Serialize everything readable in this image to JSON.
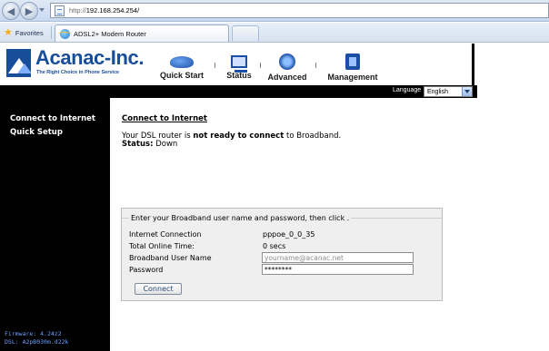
{
  "browser": {
    "address": {
      "scheme": "http://",
      "host": "192.168.254.254/"
    },
    "favorites_label": "Favorites",
    "tab_title": "ADSL2+ Modem Router"
  },
  "header": {
    "logo_name": "Acanac-Inc.",
    "logo_tagline": "The Right Choice in Phone Service",
    "menu": [
      {
        "label": "Quick Start",
        "icon": "quick-start-icon"
      },
      {
        "label": "Status",
        "icon": "monitor-icon"
      },
      {
        "label": "Advanced",
        "icon": "gear-icon"
      },
      {
        "label": "Management",
        "icon": "management-icon"
      }
    ],
    "language_label": "Language",
    "language_value": "English"
  },
  "sidebar": {
    "items": [
      {
        "label": "Connect to Internet"
      },
      {
        "label": "Quick Setup"
      }
    ],
    "firmware": "Firmware: 4.24z2",
    "dsl": "DSL: A2pB030m.d22k"
  },
  "main": {
    "heading": "Connect to Internet",
    "status_prefix": "Your DSL router is ",
    "status_emphasis": "not ready to connect",
    "status_suffix": " to Broadband.",
    "status_label": "Status:",
    "status_value": "Down",
    "form": {
      "instruction": "Enter your Broadband user name and password, then click .",
      "rows": [
        {
          "label": "Internet Connection",
          "value": "pppoe_0_0_35"
        },
        {
          "label": "Total Online Time:",
          "value": "0 secs"
        },
        {
          "label": "Broadband User Name"
        },
        {
          "label": "Password"
        }
      ],
      "username_placeholder": "yourname@acanac.net",
      "password_value": "********",
      "connect_label": "Connect"
    }
  },
  "colors": {
    "brand_blue": "#184d99",
    "sidebar_bg": "#000000",
    "sidebar_info": "#6aa0ff"
  }
}
